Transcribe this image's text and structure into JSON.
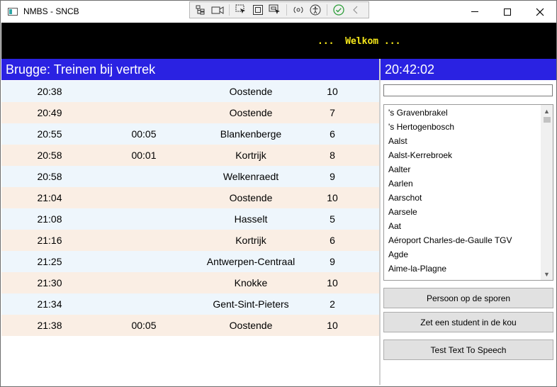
{
  "window": {
    "title": "NMBS - SNCB"
  },
  "banner": {
    "text": "...  Welkom ..."
  },
  "header": {
    "title": "Brugge: Treinen bij vertrek",
    "clock": "20:42:02"
  },
  "departures": [
    {
      "time": "20:38",
      "delay": "",
      "destination": "Oostende",
      "track": "10"
    },
    {
      "time": "20:49",
      "delay": "",
      "destination": "Oostende",
      "track": "7"
    },
    {
      "time": "20:55",
      "delay": "00:05",
      "destination": "Blankenberge",
      "track": "6"
    },
    {
      "time": "20:58",
      "delay": "00:01",
      "destination": "Kortrijk",
      "track": "8"
    },
    {
      "time": "20:58",
      "delay": "",
      "destination": "Welkenraedt",
      "track": "9"
    },
    {
      "time": "21:04",
      "delay": "",
      "destination": "Oostende",
      "track": "10"
    },
    {
      "time": "21:08",
      "delay": "",
      "destination": "Hasselt",
      "track": "5"
    },
    {
      "time": "21:16",
      "delay": "",
      "destination": "Kortrijk",
      "track": "6"
    },
    {
      "time": "21:25",
      "delay": "",
      "destination": "Antwerpen-Centraal",
      "track": "9"
    },
    {
      "time": "21:30",
      "delay": "",
      "destination": "Knokke",
      "track": "10"
    },
    {
      "time": "21:34",
      "delay": "",
      "destination": "Gent-Sint-Pieters",
      "track": "2"
    },
    {
      "time": "21:38",
      "delay": "00:05",
      "destination": "Oostende",
      "track": "10"
    }
  ],
  "search": {
    "value": ""
  },
  "stations": [
    "'s Gravenbrakel",
    "'s Hertogenbosch",
    "Aalst",
    "Aalst-Kerrebroek",
    "Aalter",
    "Aarlen",
    "Aarschot",
    "Aarsele",
    "Aat",
    "Aéroport Charles-de-Gaulle TGV",
    "Agde",
    "Aime-la-Plagne"
  ],
  "buttons": {
    "person_on_tracks": "Persoon op de sporen",
    "student": "Zet een student in de kou",
    "tts": "Test Text To Speech"
  },
  "colors": {
    "header_bg": "#2a22e2",
    "banner_bg": "#000000",
    "banner_text": "#f4e61a",
    "row_even": "#eef6fc",
    "row_odd": "#faeee4"
  },
  "icons": {
    "window_controls": [
      "minimize-icon",
      "maximize-icon",
      "close-icon"
    ],
    "debug_toolbar": [
      "live-visual-tree-icon",
      "video-record-icon",
      "select-element-icon",
      "display-layout-adorners-icon",
      "track-focused-element-icon",
      "hot-reload-icon",
      "accessibility-icon",
      "check-icon",
      "collapse-chevron-icon"
    ]
  }
}
